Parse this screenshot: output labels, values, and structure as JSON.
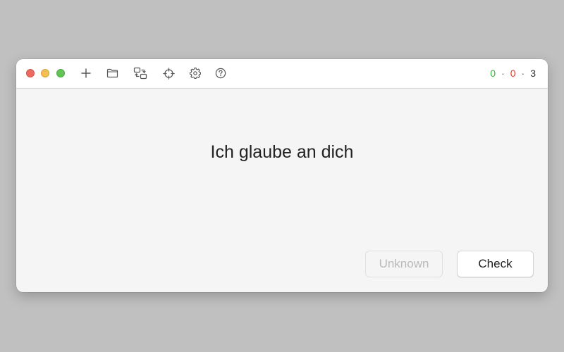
{
  "toolbar": {
    "icons": [
      "plus-icon",
      "folder-icon",
      "swap-icon",
      "crosshair-icon",
      "gear-icon",
      "help-icon"
    ]
  },
  "score": {
    "correct": "0",
    "wrong": "0",
    "remaining": "3",
    "separator": "·",
    "correct_color": "#2fb53d",
    "wrong_color": "#e0392b"
  },
  "card": {
    "phrase": "Ich glaube an dich"
  },
  "buttons": {
    "unknown_label": "Unknown",
    "check_label": "Check"
  }
}
